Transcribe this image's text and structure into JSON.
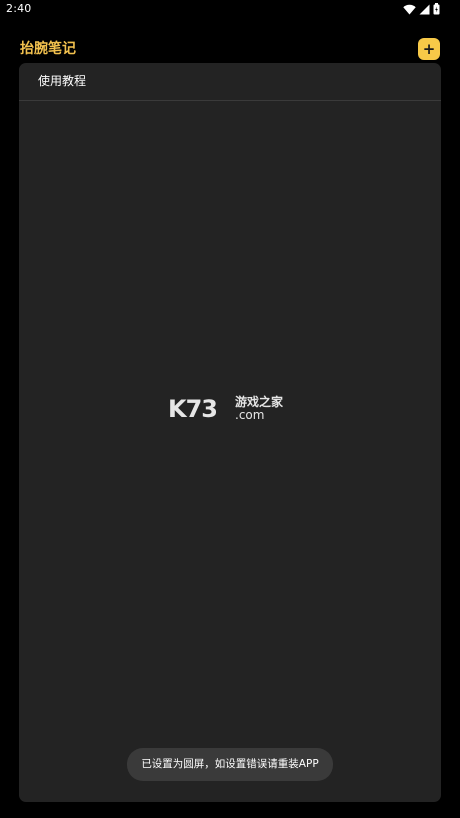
{
  "status_bar": {
    "time": "2:40",
    "icons": [
      "wifi-icon",
      "signal-icon",
      "battery-icon"
    ]
  },
  "header": {
    "title": "抬腕笔记",
    "add_button_label": "+"
  },
  "notes": {
    "items": [
      {
        "label": "使用教程"
      }
    ]
  },
  "watermark": {
    "brand": "K73",
    "name": "游戏之家",
    "domain": ".com"
  },
  "toast": {
    "message": "已设置为圆屏，如设置错误请重装APP"
  },
  "colors": {
    "background": "#000000",
    "panel": "#232323",
    "accent": "#f7c948",
    "title": "#f2c14e",
    "toast_bg": "#3a3a3a"
  }
}
